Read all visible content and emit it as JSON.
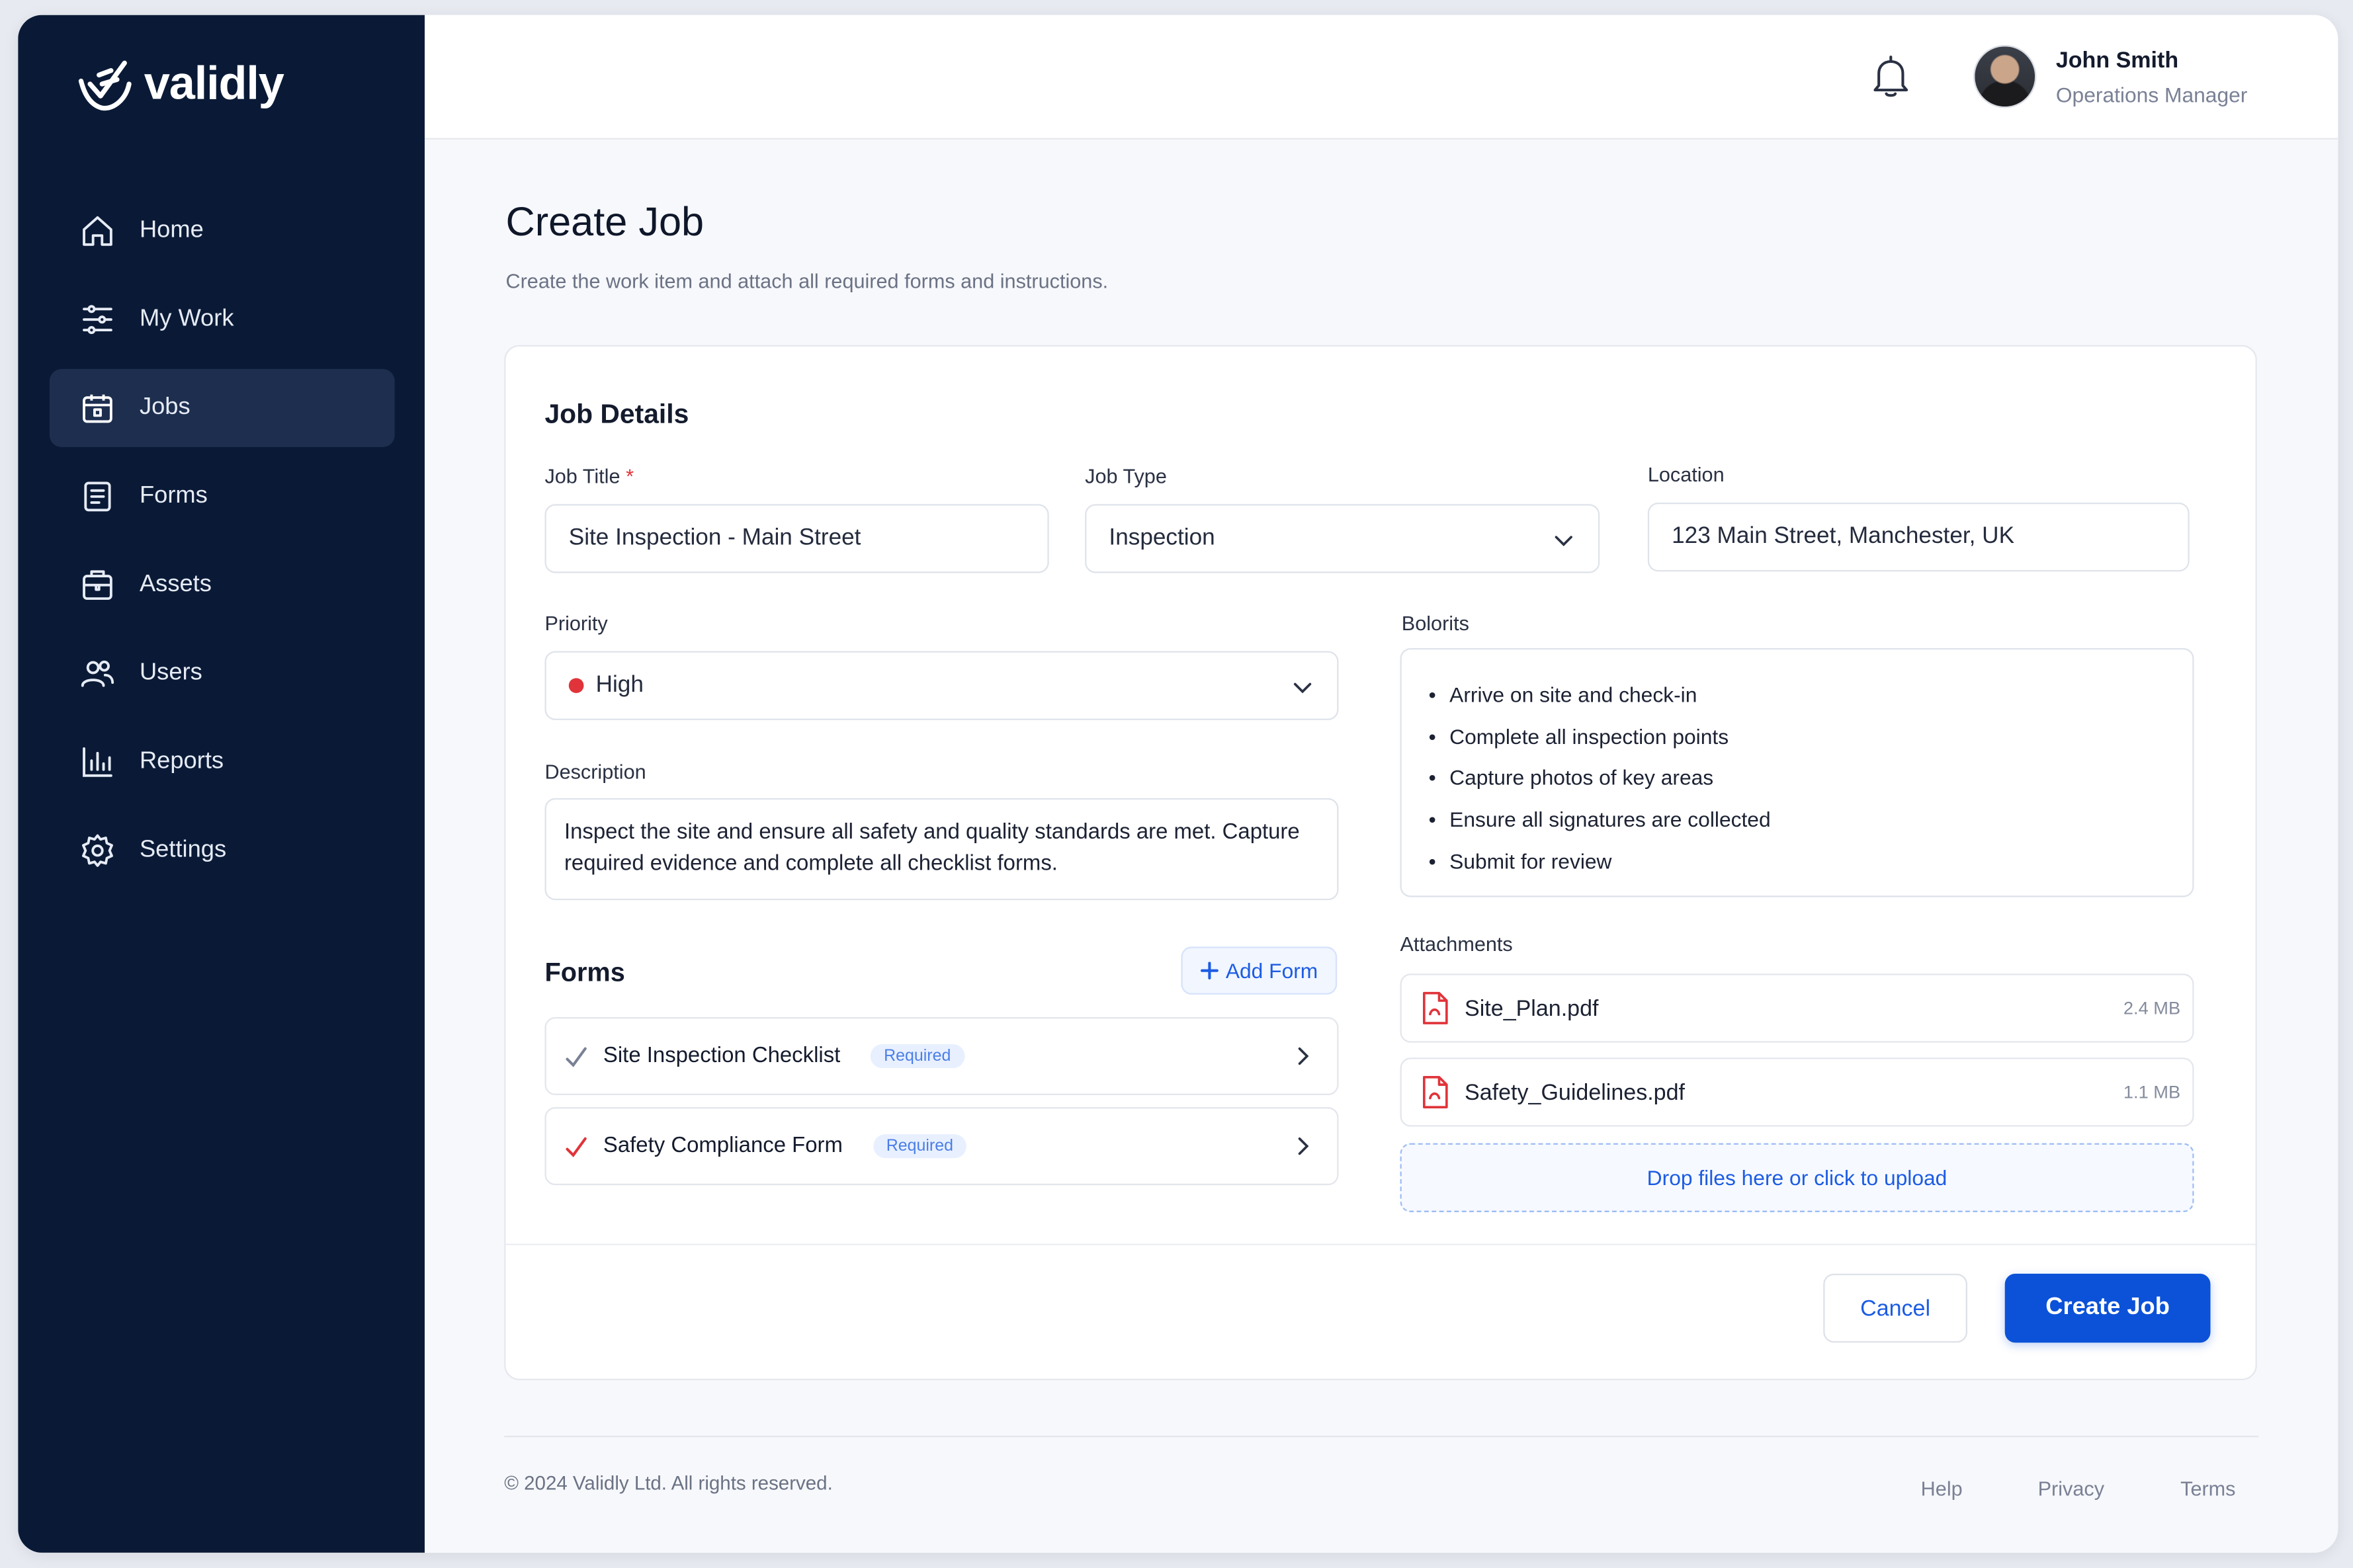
{
  "app": {
    "brand": "validly"
  },
  "sidebar": {
    "items": [
      {
        "label": "Home",
        "icon": "home-icon",
        "active": false
      },
      {
        "label": "My Work",
        "icon": "tasks-icon",
        "active": false
      },
      {
        "label": "Jobs",
        "icon": "briefcase-calendar-icon",
        "active": true
      },
      {
        "label": "Forms",
        "icon": "form-icon",
        "active": false
      },
      {
        "label": "Assets",
        "icon": "assets-icon",
        "active": false
      },
      {
        "label": "Users",
        "icon": "users-icon",
        "active": false
      },
      {
        "label": "Reports",
        "icon": "bar-chart-icon",
        "active": false
      },
      {
        "label": "Settings",
        "icon": "gear-icon",
        "active": false
      }
    ]
  },
  "header": {
    "user_name": "John Smith",
    "user_role": "Operations Manager"
  },
  "page": {
    "title": "Create Job",
    "subtitle": "Create the work item and attach all required forms and instructions."
  },
  "job_details": {
    "section_title": "Job Details",
    "job_title_label": "Job Title",
    "job_title_required_mark": "*",
    "job_title_value": "Site Inspection - Main Street",
    "job_type_label": "Job Type",
    "job_type_value": "Inspection",
    "location_label": "Location",
    "location_value": "123 Main Street, Manchester, UK",
    "priority_label": "Priority",
    "priority_value": "High",
    "description_label": "Description",
    "description_value": "Inspect the site and ensure all safety and quality standards are met. Capture required evidence and complete all checklist forms.",
    "steps_label": "Bolorits",
    "steps": [
      "Arrive on site and check-in",
      "Complete all inspection points",
      "Capture photos of key areas",
      "Ensure all signatures are collected",
      "Submit for review"
    ]
  },
  "forms": {
    "title": "Forms",
    "add_label": "Add Form",
    "items": [
      {
        "name": "Site Inspection Checklist",
        "badge": "Required"
      },
      {
        "name": "Safety Compliance Form",
        "badge": "Required"
      }
    ]
  },
  "attachments": {
    "label": "Attachments",
    "files": [
      {
        "name": "Site_Plan.pdf",
        "size": "2.4 MB"
      },
      {
        "name": "Safety_Guidelines.pdf",
        "size": "1.1 MB"
      }
    ],
    "drop_text": "Drop files here or click to upload"
  },
  "actions": {
    "cancel": "Cancel",
    "create": "Create Job"
  },
  "footer": {
    "copyright": "© 2024 Validly Ltd. All rights reserved.",
    "links": [
      "Help",
      "Privacy",
      "Terms"
    ]
  },
  "colors": {
    "sidebar_bg": "#0a1a36",
    "sidebar_active": "#1d2e4f",
    "primary": "#0b52d8",
    "priority_high": "#e0343a"
  }
}
